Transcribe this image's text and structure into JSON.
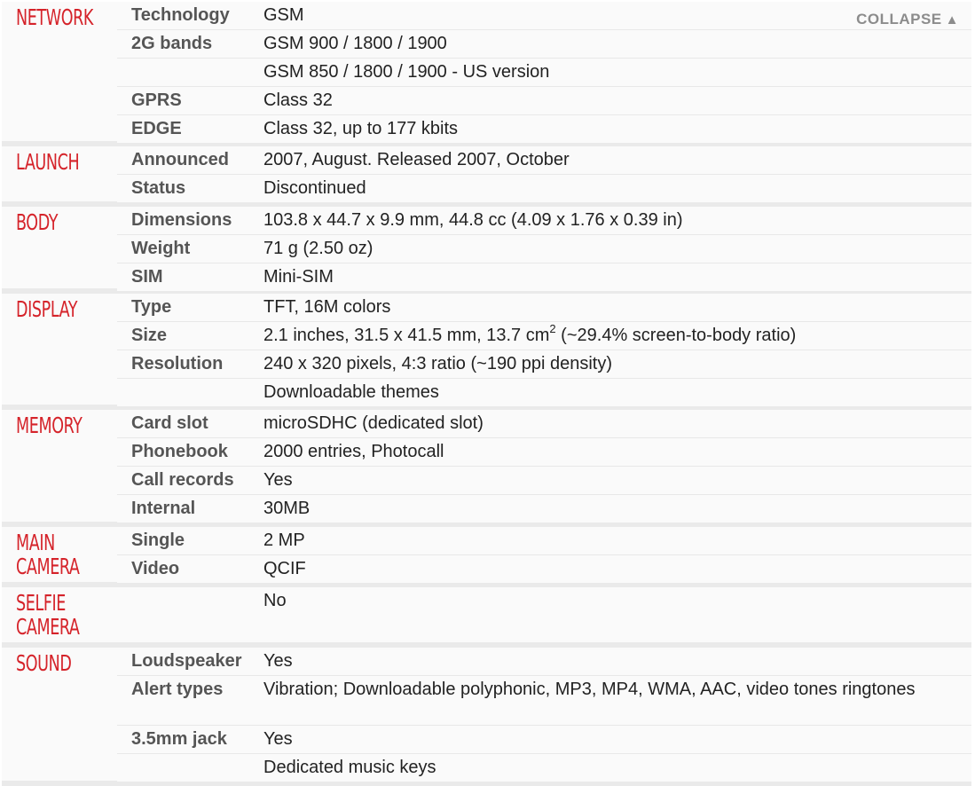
{
  "collapse": {
    "label": "COLLAPSE",
    "arrow": "▲"
  },
  "sections": [
    {
      "id": "network",
      "title": "NETWORK",
      "rows": [
        {
          "label": "Technology",
          "value": "GSM"
        },
        {
          "label": "2G bands",
          "value": "GSM 900 / 1800 / 1900"
        },
        {
          "label": "",
          "value": "GSM 850 / 1800 / 1900 - US version"
        },
        {
          "label": "GPRS",
          "value": "Class 32"
        },
        {
          "label": "EDGE",
          "value": "Class 32, up to 177 kbits"
        }
      ]
    },
    {
      "id": "launch",
      "title": "LAUNCH",
      "rows": [
        {
          "label": "Announced",
          "value": "2007, August. Released 2007, October"
        },
        {
          "label": "Status",
          "value": "Discontinued"
        }
      ]
    },
    {
      "id": "body",
      "title": "BODY",
      "rows": [
        {
          "label": "Dimensions",
          "value": "103.8 x 44.7 x 9.9 mm, 44.8 cc (4.09 x 1.76 x 0.39 in)"
        },
        {
          "label": "Weight",
          "value": "71 g (2.50 oz)"
        },
        {
          "label": "SIM",
          "value": "Mini-SIM"
        }
      ]
    },
    {
      "id": "display",
      "title": "DISPLAY",
      "rows": [
        {
          "label": "Type",
          "value": "TFT, 16M colors"
        },
        {
          "label": "Size",
          "value": "2.1 inches, 31.5 x 41.5 mm, 13.7 cm",
          "sup": "2",
          "value_after": " (~29.4% screen-to-body ratio)"
        },
        {
          "label": "Resolution",
          "value": "240 x 320 pixels, 4:3 ratio (~190 ppi density)"
        },
        {
          "label": "",
          "value": "Downloadable themes"
        }
      ]
    },
    {
      "id": "memory",
      "title": "MEMORY",
      "rows": [
        {
          "label": "Card slot",
          "value": "microSDHC (dedicated slot)"
        },
        {
          "label": "Phonebook",
          "value": "2000 entries, Photocall"
        },
        {
          "label": "Call records",
          "value": "Yes"
        },
        {
          "label": "Internal",
          "value": "30MB"
        }
      ]
    },
    {
      "id": "main-camera",
      "title": "MAIN\nCAMERA",
      "rows": [
        {
          "label": "Single",
          "value": "2 MP"
        },
        {
          "label": "Video",
          "value": "QCIF"
        }
      ]
    },
    {
      "id": "selfie-camera",
      "title": "SELFIE\nCAMERA",
      "rows": [
        {
          "label": "",
          "value": "No"
        }
      ]
    },
    {
      "id": "sound",
      "title": "SOUND",
      "rows": [
        {
          "label": "Loudspeaker",
          "value": "Yes"
        },
        {
          "label": "Alert types",
          "value": "Vibration; Downloadable polyphonic, MP3, MP4, WMA, AAC, video tones ringtones"
        },
        {
          "label": "3.5mm jack",
          "value": "Yes"
        },
        {
          "label": "",
          "value": "Dedicated music keys"
        }
      ]
    }
  ]
}
